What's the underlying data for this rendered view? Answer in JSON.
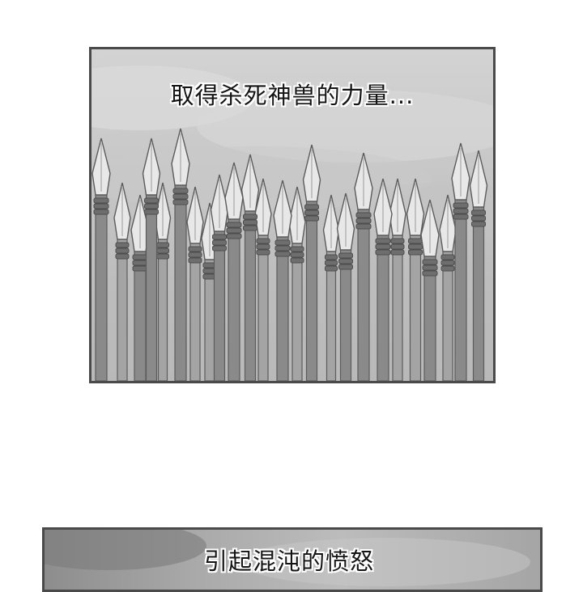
{
  "panels": [
    {
      "caption": "取得杀死神兽的力量..."
    },
    {
      "caption": "引起混沌的愤怒"
    }
  ],
  "colors": {
    "border": "#4a4a4a",
    "sky_light": "#d3d3d3",
    "spear_back": "#a4a4a4",
    "spear_front": "#8a8a8a",
    "blade": "#e8e8e8",
    "binding": "#6e6e6e"
  }
}
